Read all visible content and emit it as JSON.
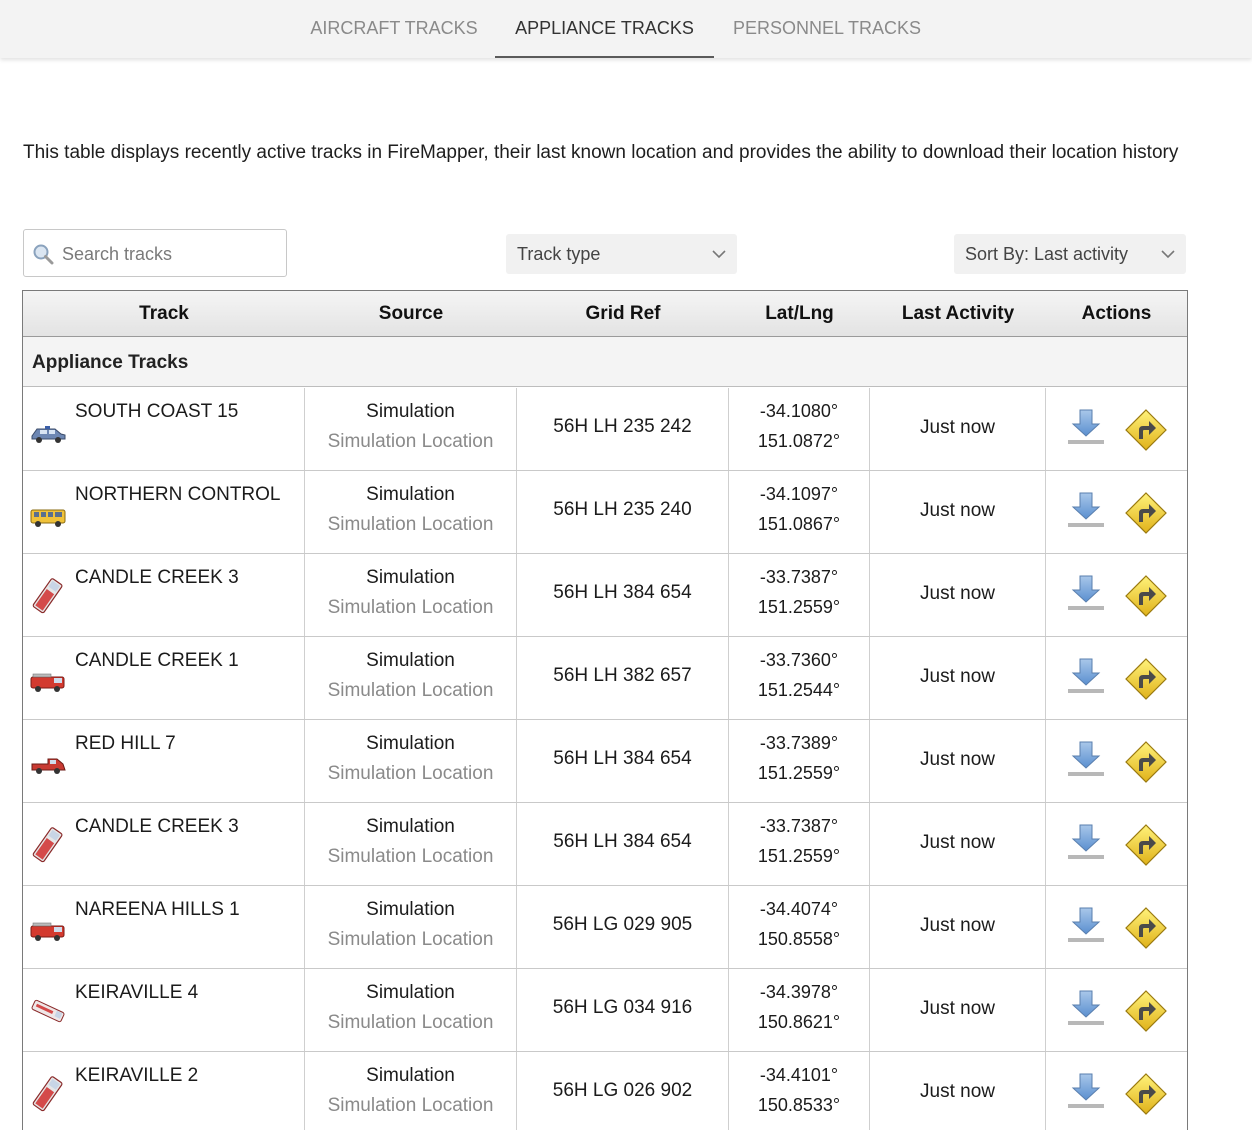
{
  "tabs": [
    {
      "label": "AIRCRAFT TRACKS",
      "active": false
    },
    {
      "label": "APPLIANCE TRACKS",
      "active": true
    },
    {
      "label": "PERSONNEL TRACKS",
      "active": false
    }
  ],
  "intro": "This table displays recently active tracks in FireMapper, their last known location and provides the ability to download their location history",
  "search": {
    "placeholder": "Search tracks",
    "value": ""
  },
  "filter": {
    "track_type": "Track type",
    "sort": "Sort By: Last activity"
  },
  "table": {
    "headers": {
      "track": "Track",
      "source": "Source",
      "grid": "Grid Ref",
      "latlng": "Lat/Lng",
      "activity": "Last Activity",
      "actions": "Actions"
    },
    "group": "Appliance Tracks",
    "rows": [
      {
        "name": "SOUTH COAST 15",
        "icon": "police-car-icon",
        "source": "Simulation",
        "source_loc": "Simulation Location",
        "grid": "56H LH 235 242",
        "lat": "-34.1080°",
        "lng": "151.0872°",
        "activity": "Just now"
      },
      {
        "name": "NORTHERN CONTROL",
        "icon": "bus-icon",
        "source": "Simulation",
        "source_loc": "Simulation Location",
        "grid": "56H LH 235 240",
        "lat": "-34.1097°",
        "lng": "151.0867°",
        "activity": "Just now"
      },
      {
        "name": "CANDLE CREEK 3",
        "icon": "tanker-icon",
        "source": "Simulation",
        "source_loc": "Simulation Location",
        "grid": "56H LH 384 654",
        "lat": "-33.7387°",
        "lng": "151.2559°",
        "activity": "Just now"
      },
      {
        "name": "CANDLE CREEK 1",
        "icon": "fire-truck-icon",
        "source": "Simulation",
        "source_loc": "Simulation Location",
        "grid": "56H LH 382 657",
        "lat": "-33.7360°",
        "lng": "151.2544°",
        "activity": "Just now"
      },
      {
        "name": "RED HILL 7",
        "icon": "utility-truck-icon",
        "source": "Simulation",
        "source_loc": "Simulation Location",
        "grid": "56H LH 384 654",
        "lat": "-33.7389°",
        "lng": "151.2559°",
        "activity": "Just now"
      },
      {
        "name": "CANDLE CREEK 3",
        "icon": "tanker-icon",
        "source": "Simulation",
        "source_loc": "Simulation Location",
        "grid": "56H LH 384 654",
        "lat": "-33.7387°",
        "lng": "151.2559°",
        "activity": "Just now"
      },
      {
        "name": "NAREENA HILLS 1",
        "icon": "fire-truck-icon",
        "source": "Simulation",
        "source_loc": "Simulation Location",
        "grid": "56H LG 029 905",
        "lat": "-34.4074°",
        "lng": "150.8558°",
        "activity": "Just now"
      },
      {
        "name": "KEIRAVILLE 4",
        "icon": "ambulance-icon",
        "source": "Simulation",
        "source_loc": "Simulation Location",
        "grid": "56H LG 034 916",
        "lat": "-34.3978°",
        "lng": "150.8621°",
        "activity": "Just now"
      },
      {
        "name": "KEIRAVILLE 2",
        "icon": "tanker-icon",
        "source": "Simulation",
        "source_loc": "Simulation Location",
        "grid": "56H LG 026 902",
        "lat": "-34.4101°",
        "lng": "150.8533°",
        "activity": "Just now"
      }
    ]
  }
}
